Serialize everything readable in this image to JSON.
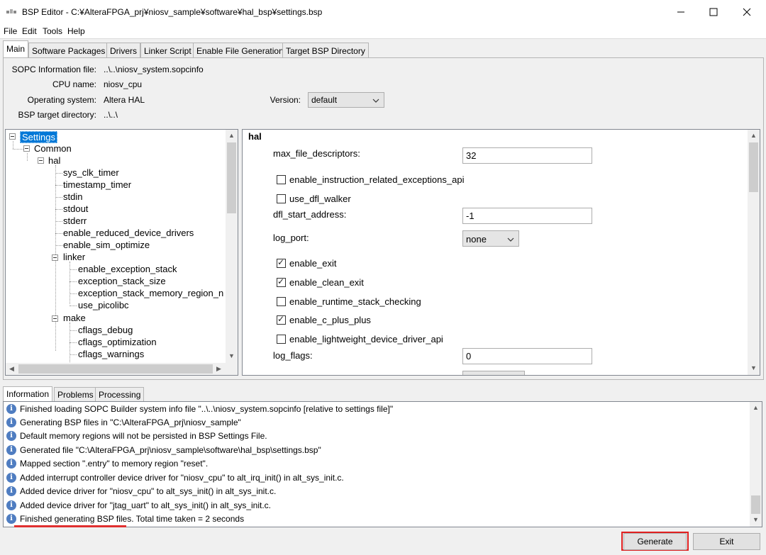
{
  "window": {
    "title": "BSP Editor - C:¥AlteraFPGA_prj¥niosv_sample¥software¥hal_bsp¥settings.bsp",
    "minimize": "—",
    "maximize": "☐",
    "close": "✕"
  },
  "menu": [
    "File",
    "Edit",
    "Tools",
    "Help"
  ],
  "tabs": [
    "Main",
    "Software Packages",
    "Drivers",
    "Linker Script",
    "Enable File Generation",
    "Target BSP Directory"
  ],
  "info": {
    "sopc_label": "SOPC Information file:",
    "sopc_value": "..\\..\\niosv_system.sopcinfo",
    "cpu_label": "CPU name:",
    "cpu_value": "niosv_cpu",
    "os_label": "Operating system:",
    "os_value": "Altera HAL",
    "version_label": "Version:",
    "version_value": "default",
    "bsp_dir_label": "BSP target directory:",
    "bsp_dir_value": "..\\..\\"
  },
  "tree": {
    "root": "Settings",
    "common": "Common",
    "hal": "hal",
    "hal_items": [
      "sys_clk_timer",
      "timestamp_timer",
      "stdin",
      "stdout",
      "stderr",
      "enable_reduced_device_drivers",
      "enable_sim_optimize"
    ],
    "linker": "linker",
    "linker_items": [
      "enable_exception_stack",
      "exception_stack_size",
      "exception_stack_memory_region_n",
      "use_picolibc"
    ],
    "make": "make",
    "make_items": [
      "cflags_debug",
      "cflags_optimization",
      "cflags_warnings"
    ]
  },
  "settings": {
    "header": "hal",
    "max_file_descriptors_label": "max_file_descriptors:",
    "max_file_descriptors_value": "32",
    "enable_instruction_related_exceptions_api": "enable_instruction_related_exceptions_api",
    "use_dfl_walker": "use_dfl_walker",
    "dfl_start_address_label": "dfl_start_address:",
    "dfl_start_address_value": "-1",
    "log_port_label": "log_port:",
    "log_port_value": "none",
    "enable_exit": "enable_exit",
    "enable_clean_exit": "enable_clean_exit",
    "enable_runtime_stack_checking": "enable_runtime_stack_checking",
    "enable_c_plus_plus": "enable_c_plus_plus",
    "enable_lightweight_device_driver_api": "enable_lightweight_device_driver_api",
    "log_flags_label": "log_flags:",
    "log_flags_value": "0",
    "checked": {
      "enable_instruction_related_exceptions_api": false,
      "use_dfl_walker": false,
      "enable_exit": true,
      "enable_clean_exit": true,
      "enable_runtime_stack_checking": false,
      "enable_c_plus_plus": true,
      "enable_lightweight_device_driver_api": false
    }
  },
  "bottom_tabs": [
    "Information",
    "Problems",
    "Processing"
  ],
  "log": [
    "Finished loading SOPC Builder system info file \"..\\..\\niosv_system.sopcinfo [relative to settings file]\"",
    "Generating BSP files in \"C:\\AlteraFPGA_prj\\niosv_sample\"",
    "Default memory regions will not be persisted in BSP Settings File.",
    "Generated file \"C:\\AlteraFPGA_prj\\niosv_sample\\software\\hal_bsp\\settings.bsp\"",
    "Mapped section \".entry\" to memory region \"reset\".",
    "Added interrupt controller device driver for \"niosv_cpu\" to alt_irq_init() in alt_sys_init.c.",
    "Added device driver for \"niosv_cpu\" to alt_sys_init() in alt_sys_init.c.",
    "Added device driver for \"jtag_uart\" to alt_sys_init() in alt_sys_init.c.",
    "Finished generating BSP files. Total time taken = 2 seconds"
  ],
  "buttons": {
    "generate": "Generate",
    "exit": "Exit"
  }
}
